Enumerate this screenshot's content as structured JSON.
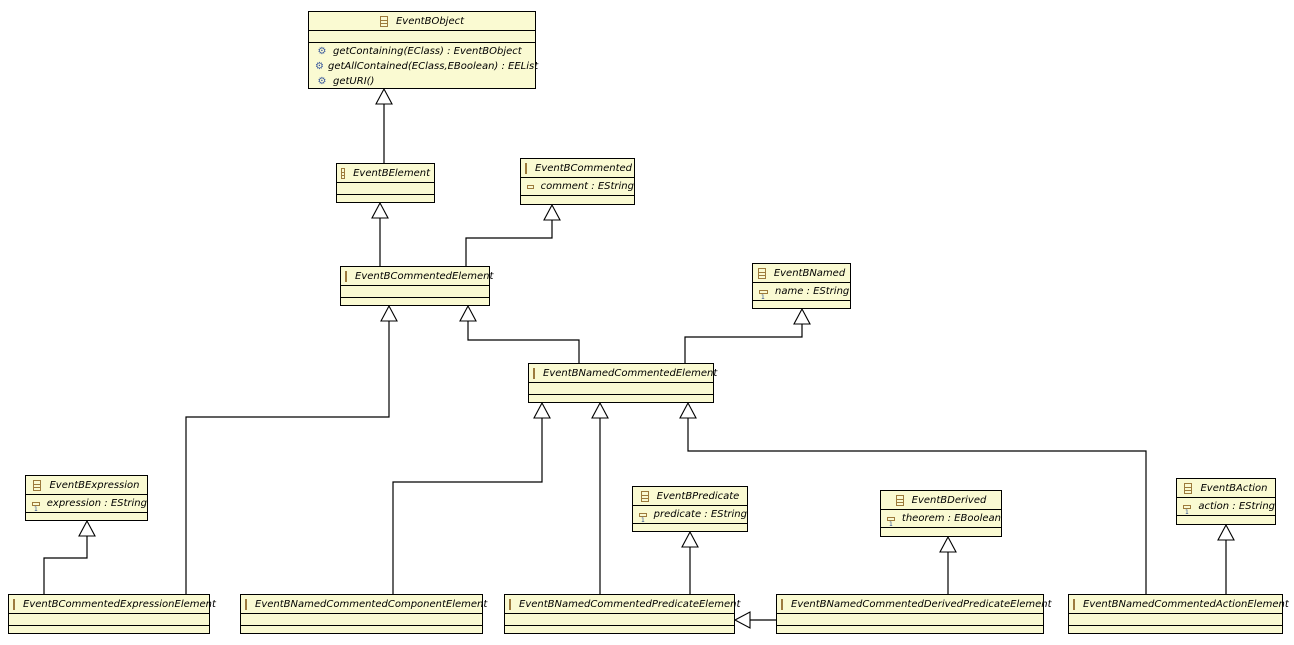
{
  "diagram": {
    "type": "UML class diagram",
    "classes": [
      {
        "id": "EventBObject",
        "name": "EventBObject",
        "attributes": [],
        "operations": [
          "getContaining(EClass) : EventBObject",
          "getAllContained(EClass,EBoolean) : EEList",
          "getURI()"
        ]
      },
      {
        "id": "EventBElement",
        "name": "EventBElement",
        "attributes": [],
        "operations": []
      },
      {
        "id": "EventBCommented",
        "name": "EventBCommented",
        "attributes": [
          {
            "text": "comment : EString",
            "kind": "plain"
          }
        ],
        "operations": []
      },
      {
        "id": "EventBCommentedElement",
        "name": "EventBCommentedElement",
        "attributes": [],
        "operations": []
      },
      {
        "id": "EventBNamed",
        "name": "EventBNamed",
        "attributes": [
          {
            "text": "name : EString",
            "kind": "one"
          }
        ],
        "operations": []
      },
      {
        "id": "EventBNamedCommentedElement",
        "name": "EventBNamedCommentedElement",
        "attributes": [],
        "operations": []
      },
      {
        "id": "EventBExpression",
        "name": "EventBExpression",
        "attributes": [
          {
            "text": "expression : EString",
            "kind": "one"
          }
        ],
        "operations": []
      },
      {
        "id": "EventBPredicate",
        "name": "EventBPredicate",
        "attributes": [
          {
            "text": "predicate : EString",
            "kind": "one"
          }
        ],
        "operations": []
      },
      {
        "id": "EventBDerived",
        "name": "EventBDerived",
        "attributes": [
          {
            "text": "theorem : EBoolean",
            "kind": "one"
          }
        ],
        "operations": []
      },
      {
        "id": "EventBAction",
        "name": "EventBAction",
        "attributes": [
          {
            "text": "action : EString",
            "kind": "one"
          }
        ],
        "operations": []
      },
      {
        "id": "EventBCommentedExpressionElement",
        "name": "EventBCommentedExpressionElement",
        "attributes": [],
        "operations": []
      },
      {
        "id": "EventBNamedCommentedComponentElement",
        "name": "EventBNamedCommentedComponentElement",
        "attributes": [],
        "operations": []
      },
      {
        "id": "EventBNamedCommentedPredicateElement",
        "name": "EventBNamedCommentedPredicateElement",
        "attributes": [],
        "operations": []
      },
      {
        "id": "EventBNamedCommentedDerivedPredicateElement",
        "name": "EventBNamedCommentedDerivedPredicateElement",
        "attributes": [],
        "operations": []
      },
      {
        "id": "EventBNamedCommentedActionElement",
        "name": "EventBNamedCommentedActionElement",
        "attributes": [],
        "operations": []
      }
    ],
    "generalizations": [
      {
        "child": "EventBElement",
        "parent": "EventBObject"
      },
      {
        "child": "EventBCommentedElement",
        "parent": "EventBElement"
      },
      {
        "child": "EventBCommentedElement",
        "parent": "EventBCommented"
      },
      {
        "child": "EventBNamedCommentedElement",
        "parent": "EventBCommentedElement"
      },
      {
        "child": "EventBNamedCommentedElement",
        "parent": "EventBNamed"
      },
      {
        "child": "EventBCommentedExpressionElement",
        "parent": "EventBExpression"
      },
      {
        "child": "EventBCommentedExpressionElement",
        "parent": "EventBCommentedElement"
      },
      {
        "child": "EventBNamedCommentedComponentElement",
        "parent": "EventBNamedCommentedElement"
      },
      {
        "child": "EventBNamedCommentedPredicateElement",
        "parent": "EventBNamedCommentedElement"
      },
      {
        "child": "EventBNamedCommentedPredicateElement",
        "parent": "EventBPredicate"
      },
      {
        "child": "EventBNamedCommentedDerivedPredicateElement",
        "parent": "EventBNamedCommentedPredicateElement"
      },
      {
        "child": "EventBNamedCommentedDerivedPredicateElement",
        "parent": "EventBDerived"
      },
      {
        "child": "EventBNamedCommentedActionElement",
        "parent": "EventBNamedCommentedElement"
      },
      {
        "child": "EventBNamedCommentedActionElement",
        "parent": "EventBAction"
      }
    ]
  }
}
